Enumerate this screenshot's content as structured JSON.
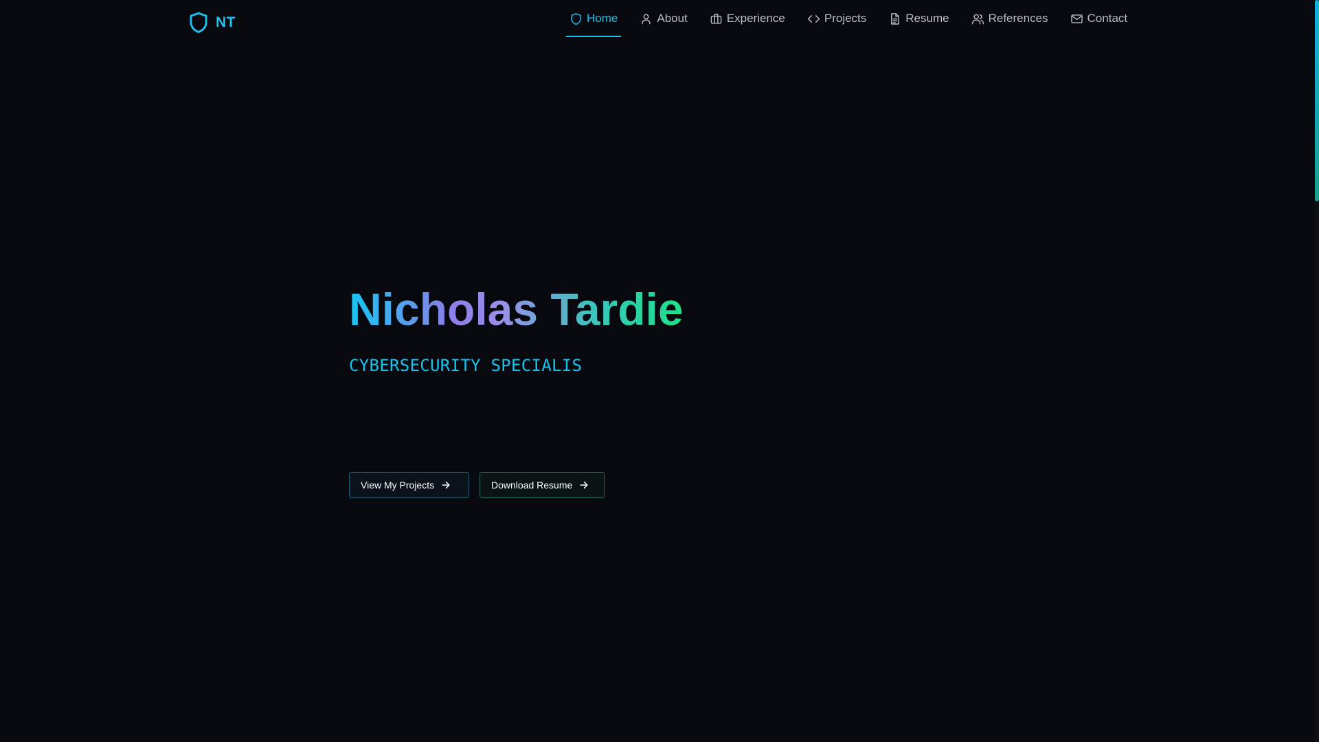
{
  "logo": {
    "text": "NT",
    "icon": "shield-icon",
    "color": "#19c3f0"
  },
  "nav": {
    "items": [
      {
        "label": "Home",
        "icon": "shield-icon",
        "active": true
      },
      {
        "label": "About",
        "icon": "user-icon",
        "active": false
      },
      {
        "label": "Experience",
        "icon": "briefcase-icon",
        "active": false
      },
      {
        "label": "Projects",
        "icon": "code-icon",
        "active": false
      },
      {
        "label": "Resume",
        "icon": "document-icon",
        "active": false
      },
      {
        "label": "References",
        "icon": "users-icon",
        "active": false
      },
      {
        "label": "Contact",
        "icon": "mail-icon",
        "active": false
      }
    ],
    "active_color": "#19c3f0",
    "inactive_color": "#b9bfc9"
  },
  "hero": {
    "name": "Nicholas Tardie",
    "subtitle": "CYBERSECURITY SPECIALIS",
    "gradient_colors": [
      "#16c6f3",
      "#8a7fe8",
      "#37c7b8",
      "#1ee08a"
    ]
  },
  "buttons": {
    "projects_label": "View My Projects",
    "resume_label": "Download Resume",
    "arrow_icon": "arrow-right-icon"
  },
  "theme": {
    "background": "#07090f",
    "accent": "#19c3f0"
  },
  "scroll": {
    "position_fraction": 0.0
  }
}
